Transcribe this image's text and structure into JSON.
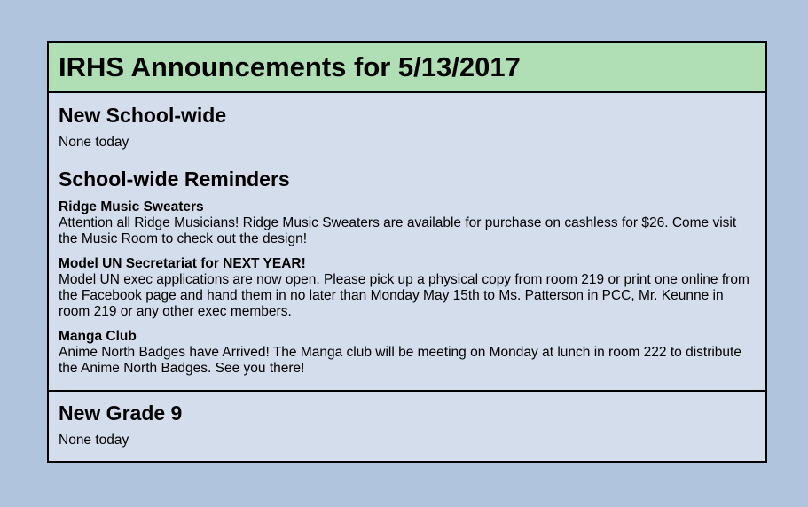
{
  "header": {
    "title": "IRHS Announcements for 5/13/2017"
  },
  "sections": {
    "new_school_wide": {
      "heading": "New School-wide",
      "text": "None today"
    },
    "reminders": {
      "heading": "School-wide Reminders",
      "items": [
        {
          "title": "Ridge Music Sweaters",
          "body": "Attention all Ridge Musicians! Ridge Music Sweaters are available for purchase on cashless for $26. Come visit the Music Room to check out the design!"
        },
        {
          "title": "Model UN Secretariat for NEXT YEAR!",
          "body": "Model UN exec applications are now open. Please pick up a physical copy from room 219 or print one online from the Facebook page and hand them in no later than Monday May 15th to Ms. Patterson in PCC, Mr. Keunne in room 219 or any other exec members."
        },
        {
          "title": "Manga Club",
          "body": "Anime North Badges have Arrived! The Manga club will be meeting on Monday at lunch in room 222 to distribute the Anime North Badges. See you there!"
        }
      ]
    },
    "new_grade_9": {
      "heading": "New Grade 9",
      "text": "None today"
    }
  },
  "colors": {
    "page_background": "#b0c4de",
    "header_background": "#b0dfb5",
    "content_background": "#d3ddec"
  }
}
